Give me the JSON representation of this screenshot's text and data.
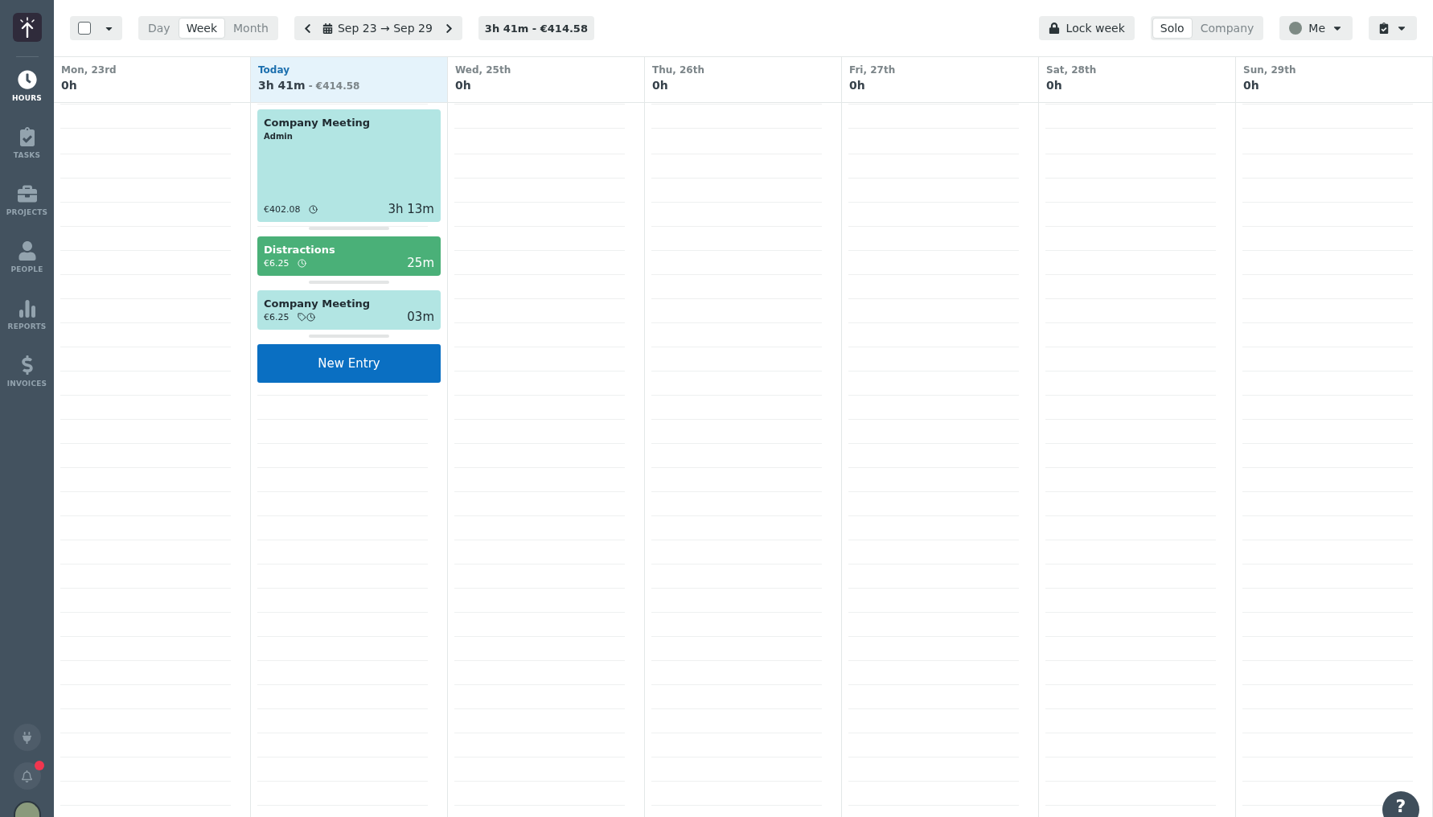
{
  "sidebar": {
    "items": [
      {
        "label": "HOURS",
        "selected": true
      },
      {
        "label": "TASKS",
        "selected": false
      },
      {
        "label": "PROJECTS",
        "selected": false
      },
      {
        "label": "PEOPLE",
        "selected": false
      },
      {
        "label": "REPORTS",
        "selected": false
      },
      {
        "label": "INVOICES",
        "selected": false
      }
    ],
    "notifications_unread": true
  },
  "toolbar": {
    "select_all_checked": false,
    "views": [
      {
        "label": "Day",
        "selected": false
      },
      {
        "label": "Week",
        "selected": true
      },
      {
        "label": "Month",
        "selected": false
      }
    ],
    "date_range": "Sep 23 → Sep 29",
    "week_total": "3h 41m - €414.58",
    "lock_label": "Lock week",
    "scopes": [
      {
        "label": "Solo",
        "selected": true
      },
      {
        "label": "Company",
        "selected": false
      }
    ],
    "user": "Me"
  },
  "days": [
    {
      "label": "Mon, 23rd",
      "total": "0h",
      "today": false
    },
    {
      "label": "Today",
      "total": "3h 41m",
      "amount": "- €414.58",
      "today": true,
      "entries": [
        {
          "title": "Company Meeting",
          "subtitle": "Admin",
          "amount": "€402.08",
          "duration": "3h 13m",
          "color": "#b2e5e3",
          "tagged": false
        },
        {
          "title": "Distractions",
          "amount": "€6.25",
          "duration": "25m",
          "color": "#4ab078",
          "tagged": false
        },
        {
          "title": "Company Meeting",
          "amount": "€6.25",
          "duration": "03m",
          "color": "#b2e5e3",
          "tagged": true
        }
      ],
      "new_entry": "New Entry"
    },
    {
      "label": "Wed, 25th",
      "total": "0h",
      "today": false
    },
    {
      "label": "Thu, 26th",
      "total": "0h",
      "today": false
    },
    {
      "label": "Fri, 27th",
      "total": "0h",
      "today": false
    },
    {
      "label": "Sat, 28th",
      "total": "0h",
      "today": false
    },
    {
      "label": "Sun, 29th",
      "total": "0h",
      "today": false
    }
  ],
  "help": "?"
}
